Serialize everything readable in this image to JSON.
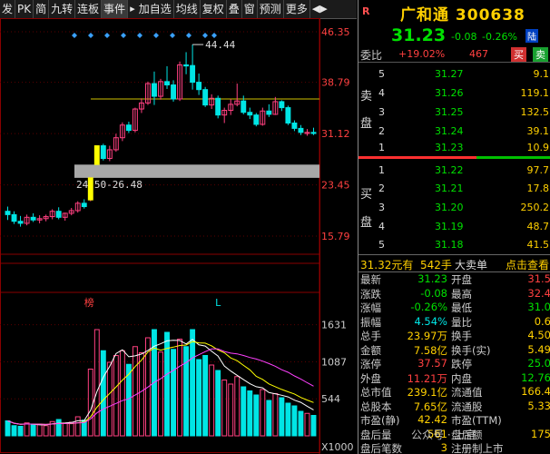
{
  "toolbar": {
    "items": [
      "发",
      "PK",
      "简",
      "九转",
      "连板",
      "事件",
      "加自选",
      "均线",
      "复权",
      "叠",
      "窗",
      "预测",
      "更多"
    ],
    "play_icon": "◀▶"
  },
  "chart": {
    "price_axis_labels": [
      "46.35",
      "38.79",
      "31.12",
      "23.45",
      "15.79"
    ],
    "volume_axis_labels": [
      "1631",
      "1087",
      "544",
      "X1000"
    ],
    "max_label": "44.44",
    "gap_label": "24.50-26.48",
    "event_marks": [
      "榜",
      "L"
    ],
    "colors": {
      "up": "#ff4080",
      "down": "#00e5e5",
      "cross": "#ffff00",
      "ma5": "#ffffff",
      "ma10": "#ffff00",
      "ma20": "#ff40ff"
    }
  },
  "chart_data": {
    "type": "candlestick",
    "ylim": [
      15.79,
      46.35
    ],
    "candles": [
      {
        "o": 19.5,
        "h": 20.2,
        "l": 18.2,
        "c": 19.0
      },
      {
        "o": 19.0,
        "h": 19.5,
        "l": 17.6,
        "c": 18.0
      },
      {
        "o": 18.0,
        "h": 18.8,
        "l": 17.2,
        "c": 17.7
      },
      {
        "o": 17.7,
        "h": 19.0,
        "l": 17.4,
        "c": 18.6
      },
      {
        "o": 18.6,
        "h": 19.2,
        "l": 17.9,
        "c": 18.2
      },
      {
        "o": 18.2,
        "h": 18.9,
        "l": 17.7,
        "c": 18.4
      },
      {
        "o": 18.4,
        "h": 19.0,
        "l": 18.0,
        "c": 18.7
      },
      {
        "o": 18.7,
        "h": 19.8,
        "l": 18.3,
        "c": 19.5
      },
      {
        "o": 19.5,
        "h": 20.1,
        "l": 18.3,
        "c": 18.6
      },
      {
        "o": 18.6,
        "h": 19.3,
        "l": 18.1,
        "c": 19.2
      },
      {
        "o": 19.2,
        "h": 20.0,
        "l": 18.9,
        "c": 19.6
      },
      {
        "o": 19.6,
        "h": 21.0,
        "l": 19.3,
        "c": 20.7
      },
      {
        "o": 20.7,
        "h": 21.3,
        "l": 19.9,
        "c": 20.2
      },
      {
        "o": 21.2,
        "h": 24.6,
        "l": 21.0,
        "c": 24.5
      },
      {
        "o": 26.5,
        "h": 29.3,
        "l": 26.5,
        "c": 29.3
      },
      {
        "o": 29.3,
        "h": 29.6,
        "l": 27.1,
        "c": 27.4
      },
      {
        "o": 27.4,
        "h": 29.3,
        "l": 27.0,
        "c": 28.7
      },
      {
        "o": 28.7,
        "h": 31.1,
        "l": 28.4,
        "c": 30.5
      },
      {
        "o": 30.5,
        "h": 32.8,
        "l": 30.0,
        "c": 32.4
      },
      {
        "o": 32.4,
        "h": 32.9,
        "l": 31.2,
        "c": 31.6
      },
      {
        "o": 31.6,
        "h": 35.0,
        "l": 31.3,
        "c": 34.8
      },
      {
        "o": 34.8,
        "h": 36.4,
        "l": 34.2,
        "c": 35.7
      },
      {
        "o": 35.7,
        "h": 38.9,
        "l": 35.4,
        "c": 38.6
      },
      {
        "o": 38.6,
        "h": 40.4,
        "l": 35.4,
        "c": 36.7
      },
      {
        "o": 36.7,
        "h": 39.3,
        "l": 36.2,
        "c": 38.9
      },
      {
        "o": 38.9,
        "h": 41.2,
        "l": 37.8,
        "c": 38.4
      },
      {
        "o": 38.4,
        "h": 39.1,
        "l": 35.9,
        "c": 36.3
      },
      {
        "o": 36.3,
        "h": 41.9,
        "l": 36.0,
        "c": 41.4
      },
      {
        "o": 41.4,
        "h": 43.3,
        "l": 40.0,
        "c": 41.3
      },
      {
        "o": 41.3,
        "h": 44.44,
        "l": 37.7,
        "c": 38.8
      },
      {
        "o": 38.8,
        "h": 40.1,
        "l": 36.9,
        "c": 37.7
      },
      {
        "o": 37.7,
        "h": 38.1,
        "l": 35.1,
        "c": 35.4
      },
      {
        "o": 35.4,
        "h": 37.0,
        "l": 34.8,
        "c": 36.4
      },
      {
        "o": 36.4,
        "h": 36.8,
        "l": 33.4,
        "c": 33.9
      },
      {
        "o": 33.9,
        "h": 35.0,
        "l": 32.7,
        "c": 34.6
      },
      {
        "o": 34.6,
        "h": 36.3,
        "l": 33.9,
        "c": 35.5
      },
      {
        "o": 35.5,
        "h": 38.6,
        "l": 35.2,
        "c": 36.0
      },
      {
        "o": 36.0,
        "h": 36.8,
        "l": 34.0,
        "c": 34.3
      },
      {
        "o": 34.3,
        "h": 35.0,
        "l": 33.3,
        "c": 33.9
      },
      {
        "o": 33.9,
        "h": 34.2,
        "l": 32.2,
        "c": 32.5
      },
      {
        "o": 32.5,
        "h": 35.0,
        "l": 32.3,
        "c": 34.5
      },
      {
        "o": 34.5,
        "h": 35.5,
        "l": 33.6,
        "c": 34.0
      },
      {
        "o": 34.0,
        "h": 36.6,
        "l": 33.9,
        "c": 35.9
      },
      {
        "o": 35.9,
        "h": 36.1,
        "l": 34.5,
        "c": 35.0
      },
      {
        "o": 35.0,
        "h": 35.3,
        "l": 32.4,
        "c": 32.7
      },
      {
        "o": 32.7,
        "h": 33.1,
        "l": 31.5,
        "c": 31.9
      },
      {
        "o": 31.9,
        "h": 32.4,
        "l": 30.9,
        "c": 31.3
      },
      {
        "o": 31.3,
        "h": 31.8,
        "l": 30.8,
        "c": 31.3
      },
      {
        "o": 31.3,
        "h": 32.0,
        "l": 30.9,
        "c": 31.23
      }
    ],
    "volume_ylim": [
      0,
      1800
    ],
    "volumes": [
      220,
      150,
      140,
      190,
      160,
      170,
      150,
      210,
      240,
      180,
      200,
      280,
      230,
      980,
      1560,
      1250,
      1080,
      1180,
      1250,
      1050,
      1310,
      1220,
      1440,
      1560,
      1230,
      1520,
      1270,
      1420,
      1310,
      1560,
      1120,
      1180,
      1040,
      960,
      820,
      760,
      870,
      720,
      660,
      600,
      680,
      520,
      620,
      560,
      480,
      440,
      360,
      330,
      300
    ],
    "ma_lines": [
      "MA5",
      "MA10",
      "MA20"
    ]
  },
  "quote": {
    "R_label": "R",
    "name_code": "广和通 300638",
    "price": "31.23",
    "change": "-0.08",
    "change_pct": "-0.26%",
    "lu_badge": "陆",
    "weibi_label": "委比",
    "weibi": "+19.02%",
    "weicha": "467",
    "buy_button": "买",
    "sell_button": "卖",
    "sell_side_chars": [
      "卖",
      "盘"
    ],
    "buy_side_chars": [
      "买",
      "盘"
    ],
    "sells": [
      {
        "level": "5",
        "price": "31.27",
        "vol": "9.1"
      },
      {
        "level": "4",
        "price": "31.26",
        "vol": "119.1"
      },
      {
        "level": "3",
        "price": "31.25",
        "vol": "132.5"
      },
      {
        "level": "2",
        "price": "31.24",
        "vol": "39.1"
      },
      {
        "level": "1",
        "price": "31.23",
        "vol": "10.9"
      }
    ],
    "buys": [
      {
        "level": "1",
        "price": "31.22",
        "vol": "97.7"
      },
      {
        "level": "2",
        "price": "31.21",
        "vol": "17.8"
      },
      {
        "level": "3",
        "price": "31.20",
        "vol": "250.2"
      },
      {
        "level": "4",
        "price": "31.19",
        "vol": "48.7"
      },
      {
        "level": "5",
        "price": "31.18",
        "vol": "41.5"
      }
    ],
    "big_deal": {
      "price": "31.32元有",
      "hands": "542手",
      "label": "大卖单",
      "link": "点击查看"
    },
    "stats": [
      {
        "l1": "最新",
        "v1": "31.23",
        "c1": "#00e000",
        "l2": "开盘",
        "v2": "31.5",
        "c2": "#ff4040"
      },
      {
        "l1": "涨跌",
        "v1": "-0.08",
        "c1": "#00e000",
        "l2": "最高",
        "v2": "32.4",
        "c2": "#ff4040"
      },
      {
        "l1": "涨幅",
        "v1": "-0.26%",
        "c1": "#00e000",
        "l2": "最低",
        "v2": "31.0",
        "c2": "#00e000"
      },
      {
        "l1": "振幅",
        "v1": "4.54%",
        "c1": "#00e5e5",
        "l2": "量比",
        "v2": "0.6",
        "c2": "#ffd000"
      },
      {
        "l1": "总手",
        "v1": "23.97万",
        "c1": "#ffd000",
        "l2": "换手",
        "v2": "4.50",
        "c2": "#ffd000"
      },
      {
        "l1": "金额",
        "v1": "7.58亿",
        "c1": "#ffd000",
        "l2": "换手(实)",
        "v2": "5.49",
        "c2": "#ffd000"
      },
      {
        "l1": "涨停",
        "v1": "37.57",
        "c1": "#ff4040",
        "l2": "跌停",
        "v2": "25.0",
        "c2": "#00e000"
      },
      {
        "l1": "外盘",
        "v1": "11.21万",
        "c1": "#ff4040",
        "l2": "内盘",
        "v2": "12.76",
        "c2": "#00e000"
      },
      {
        "l1": "总市值",
        "v1": "239.1亿",
        "c1": "#ffd000",
        "l2": "流通值",
        "v2": "166.4",
        "c2": "#ffd000"
      },
      {
        "l1": "总股本",
        "v1": "7.65亿",
        "c1": "#ffd000",
        "l2": "流通股",
        "v2": "5.33",
        "c2": "#ffd000"
      },
      {
        "l1": "市盈(静)",
        "v1": "42.42",
        "c1": "#ffd000",
        "l2": "市盈(TTM)",
        "v2": "",
        "c2": "#ffd000"
      },
      {
        "l1": "盘后量",
        "v1": "561",
        "c1": "#ffd000",
        "l2": "盘后额",
        "v2": "175",
        "c2": "#ffd000"
      },
      {
        "l1": "盘后笔数",
        "v1": "3",
        "c1": "#ffd000",
        "l2": "注册制上市",
        "v2": "",
        "c2": "#ccc"
      }
    ],
    "watermark": "公众号 · 上官"
  }
}
